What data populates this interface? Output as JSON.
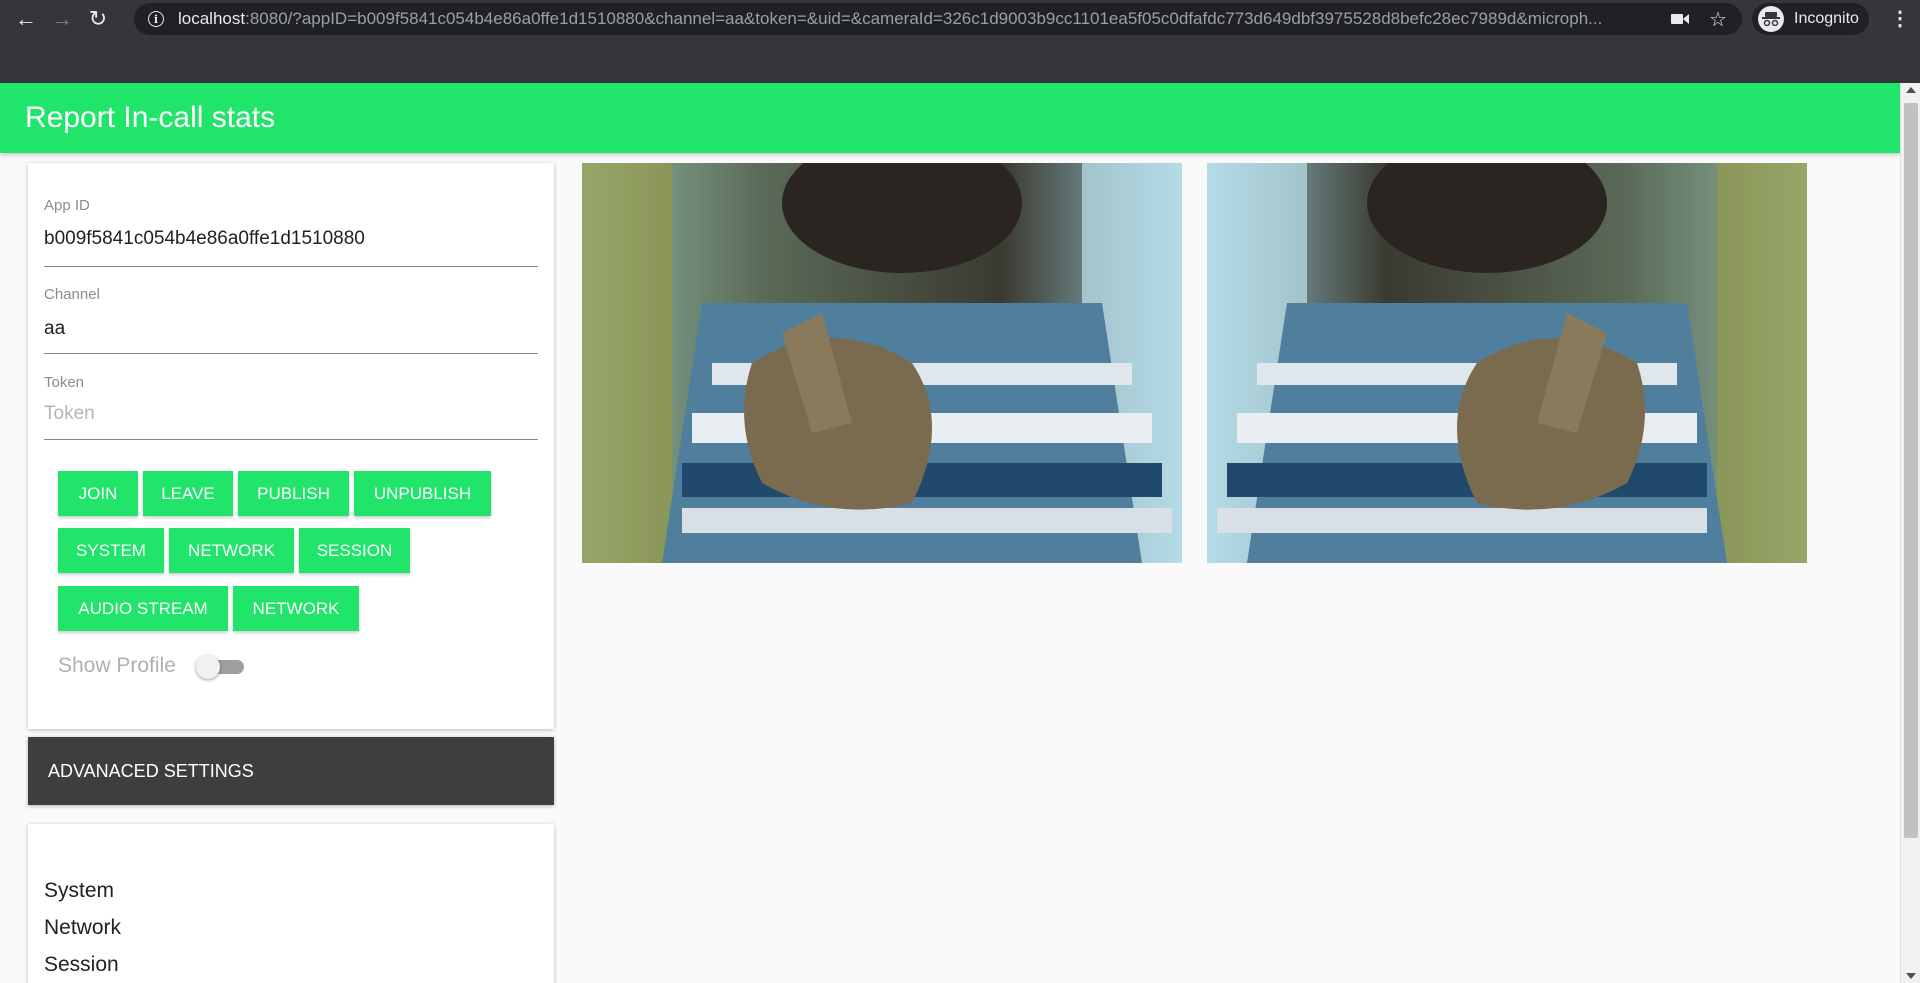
{
  "browser": {
    "url_host": "localhost",
    "url_rest": ":8080/?appID=b009f5841c054b4e86a0ffe1d1510880&channel=aa&token=&uid=&cameraId=326c1d9003b9cc1101ea5f05c0dfafdc773d649dbf3975528d8befc28ec7989d&microph...",
    "profile_label": "Incognito",
    "icons": [
      "back-icon",
      "forward-icon",
      "reload-icon",
      "info-icon",
      "camera-icon",
      "star-icon",
      "incognito-icon",
      "menu-icon"
    ]
  },
  "app": {
    "title": "Report In-call stats",
    "accent_color": "#21e46a"
  },
  "form": {
    "app_id_label": "App ID",
    "app_id_value": "b009f5841c054b4e86a0ffe1d1510880",
    "channel_label": "Channel",
    "channel_value": "aa",
    "token_label": "Token",
    "token_placeholder": "Token"
  },
  "buttons": {
    "row1": [
      "JOIN",
      "LEAVE",
      "PUBLISH",
      "UNPUBLISH"
    ],
    "row2": [
      "SYSTEM",
      "NETWORK",
      "SESSION"
    ],
    "row3": [
      "AUDIO STREAM",
      "NETWORK"
    ]
  },
  "toggle": {
    "label": "Show Profile",
    "checked": false
  },
  "advanced": {
    "label": "ADVANACED SETTINGS"
  },
  "stats": {
    "items": [
      "System",
      "Network",
      "Session"
    ]
  }
}
